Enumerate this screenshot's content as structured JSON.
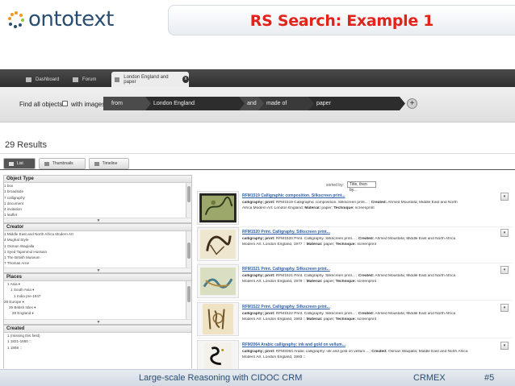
{
  "slide": {
    "logo_text": "ontotext",
    "title": "RS Search: Example 1",
    "footer_left": "Large-scale Reasoning with CIDOC CRM",
    "footer_center": "CRMEX",
    "footer_right": "#5"
  },
  "nav": {
    "tabs": [
      {
        "label": "Dashboard"
      },
      {
        "label": "Forum"
      },
      {
        "label": "London England and paper"
      }
    ],
    "close_glyph": "x"
  },
  "search": {
    "find_label": "Find all objects",
    "with_images": "with images",
    "segments": [
      "from",
      "London England",
      "and",
      "made of",
      "paper"
    ],
    "add_glyph": "+"
  },
  "results": {
    "count_label": "29 Results",
    "view_tabs": [
      "List",
      "Thumbnails",
      "Timeline"
    ],
    "sorted_label": "sorted by:",
    "sort_value": "Title, then by...",
    "items": [
      {
        "title": "RFM1519 Calligraphic composition. Silkscreen print...",
        "line1_a": "calligraphy; print:",
        "line1_b": " RFM1519 Calligraphic composition. Silkscreen print... ; ",
        "line1_c": "Created:",
        "line1_d": " Ahmed Moustafa; Middle East and North",
        "line2_a": "Africa Modern Art. London England; ",
        "line2_b": "Material:",
        "line2_c": " paper; ",
        "line2_d": "Technique:",
        "line2_e": " screenprint"
      },
      {
        "title": "RFM1520 Print. Calligraphy. Silkscreen print...",
        "line1_a": "calligraphy; print:",
        "line1_b": " RFM1520 Print. Calligraphy. Silkscreen print... ; ",
        "line1_c": "Created:",
        "line1_d": " Ahmed Moustafa; Middle East and North Africa",
        "line2_a": "Modern Art. London England, 1977 :: ",
        "line2_b": "Material:",
        "line2_c": " paper; ",
        "line2_d": "Technique:",
        "line2_e": " screenprint"
      },
      {
        "title": "RFM1521 Print. Calligraphy. Silkscreen print...",
        "line1_a": "calligraphy; print:",
        "line1_b": " RFM1521 Print. Calligraphy. Silkscreen print... ; ",
        "line1_c": "Created:",
        "line1_d": " Ahmed Moustafa; Middle East and North Africa",
        "line2_a": "Modern Art. London England, 1979 :: ",
        "line2_b": "Material:",
        "line2_c": " paper; ",
        "line2_d": "Technique:",
        "line2_e": " screenprint"
      },
      {
        "title": "RFM1522 Print. Calligraphy. Silkscreen print...",
        "line1_a": "calligraphy; print:",
        "line1_b": " RFM1522 Print. Calligraphy. Silkscreen print... ; ",
        "line1_c": "Created:",
        "line1_d": " Ahmed Moustafa; Middle East and North Africa",
        "line2_a": "Modern Art. London England, 1983 :: ",
        "line2_b": "Material:",
        "line2_c": " paper; ",
        "line2_d": "Technique:",
        "line2_e": " screenprint"
      },
      {
        "title": "RFM2064 Arabic calligraphy: ink and gold on vellum...",
        "line1_a": "calligraphy; print:",
        "line1_b": " RFM2064 Arabic calligraphy: ink and gold on vellum... ; ",
        "line1_c": "Created:",
        "line1_d": " Osman Waqialla; Middle East and North Africa",
        "line2_a": "Modern Art. London England, 1993 :: ",
        "line2_b": "",
        "line2_c": "",
        "line2_d": "",
        "line2_e": ""
      }
    ]
  },
  "facets": {
    "object_type": {
      "title": "Object Type",
      "items": [
        "1 box",
        "1 broadside",
        "7 calligraphy",
        "1 document",
        "4 invitation",
        "1 leaflet"
      ]
    },
    "creator": {
      "title": "Creator",
      "items": [
        "1 Middle East and North Africa Modern Art",
        "4 Mughal Style",
        "1 Osman Waqialla",
        "1 Syed Tajammul Hussain",
        "1 The British Museum",
        "7 Thomas Arne"
      ]
    },
    "places": {
      "title": "Places",
      "items": [
        "1 Asia ▾",
        "1 South Asia ▾",
        "1 India pre-1947",
        "28 Europe ▾",
        "29 British Isles ▾",
        "28 England ▾"
      ]
    },
    "created": {
      "title": "Created",
      "items": [
        "1 (missing this field)",
        "1 1821-1850 ::",
        "1 1868 ::"
      ]
    },
    "grip_glyph": "▼"
  },
  "colors": {
    "title_red": "#e2231a",
    "brand_blue": "#2a4e72",
    "nav_dark": "#3a3a3a",
    "link_blue": "#2e5fa8"
  }
}
